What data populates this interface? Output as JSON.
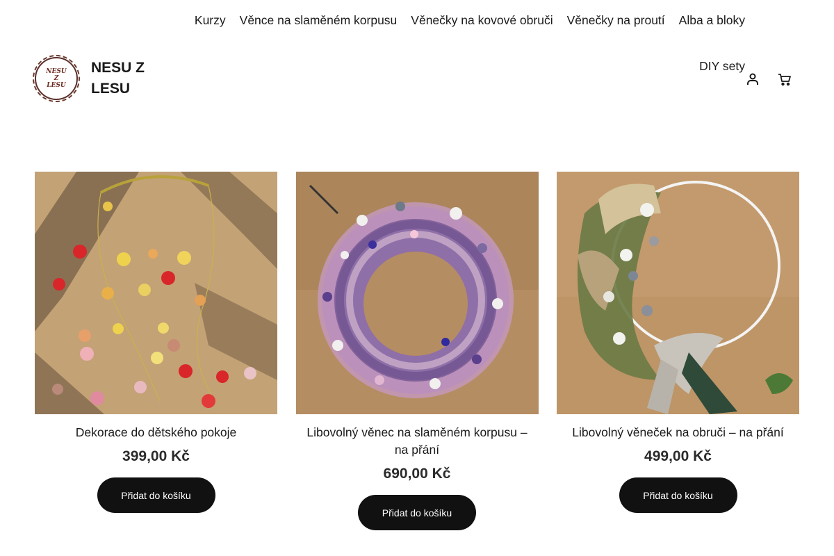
{
  "nav": {
    "items": [
      "Kurzy",
      "Věnce na slaměném korpusu",
      "Věnečky na kovové obruči",
      "Věnečky na proutí",
      "Alba a bloky",
      "DIY sety"
    ]
  },
  "brand": {
    "logo_lines": [
      "NESU",
      "Z",
      "LESU"
    ],
    "title_line1": "NESU Z",
    "title_line2": "LESU"
  },
  "header_icons": [
    "account-icon",
    "cart-icon"
  ],
  "products": [
    {
      "title": "Dekorace do dětského pokoje",
      "price": "399,00 Kč",
      "button": "Přidat do košíku"
    },
    {
      "title": "Libovolný věnec na slaměném korpusu – na přání",
      "price": "690,00 Kč",
      "button": "Přidat do košíku"
    },
    {
      "title": "Libovolný věneček na obruči – na přání",
      "price": "499,00 Kč",
      "button": "Přidat do košíku"
    }
  ],
  "colors": {
    "button_bg": "#111111",
    "text": "#1a1a1a",
    "background": "#ffffff"
  }
}
